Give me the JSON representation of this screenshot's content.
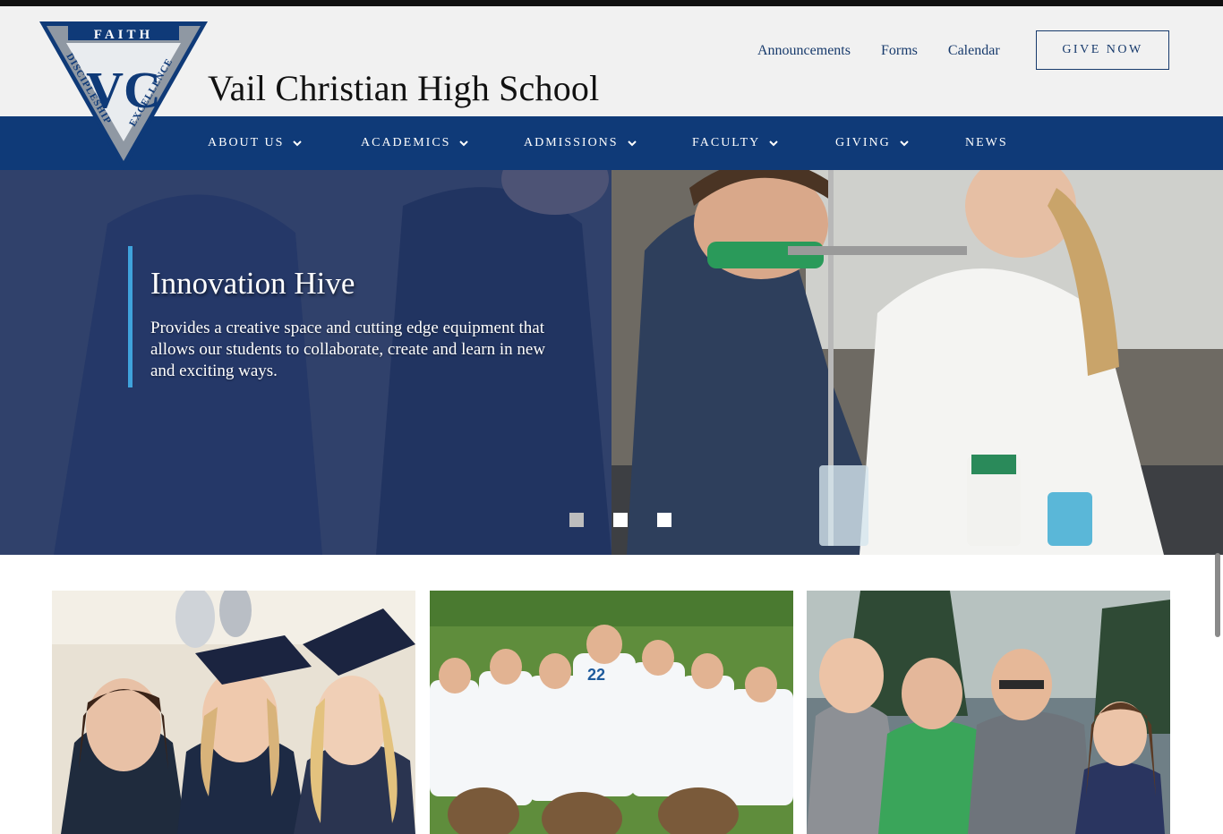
{
  "site": {
    "school_name": "Vail Christian High School",
    "logo_words": [
      "FAITH",
      "DISCIPLESHIP",
      "EXCELLENCE",
      "VC"
    ]
  },
  "utility_nav": [
    {
      "label": "Announcements"
    },
    {
      "label": "Forms"
    },
    {
      "label": "Calendar"
    }
  ],
  "give_button": {
    "label": "GIVE NOW"
  },
  "main_nav": [
    {
      "label": "ABOUT US",
      "dropdown": true
    },
    {
      "label": "ACADEMICS",
      "dropdown": true
    },
    {
      "label": "ADMISSIONS",
      "dropdown": true
    },
    {
      "label": "FACULTY",
      "dropdown": true
    },
    {
      "label": "GIVING",
      "dropdown": true
    },
    {
      "label": "NEWS",
      "dropdown": false
    }
  ],
  "hero": {
    "title": "Innovation Hive",
    "description": "Provides a creative space and cutting edge equipment that allows our students to collaborate, create and learn in new and exciting ways.",
    "slides": 3,
    "active_slide": 1
  },
  "feature_cards": [
    {
      "image": "graduates-photo"
    },
    {
      "image": "soccer-team-photo"
    },
    {
      "image": "students-group-photo"
    }
  ],
  "colors": {
    "navy": "#0f3a78",
    "header_bg": "#f1f1f1",
    "accent": "#3fa3dc",
    "link": "#173a6c"
  }
}
